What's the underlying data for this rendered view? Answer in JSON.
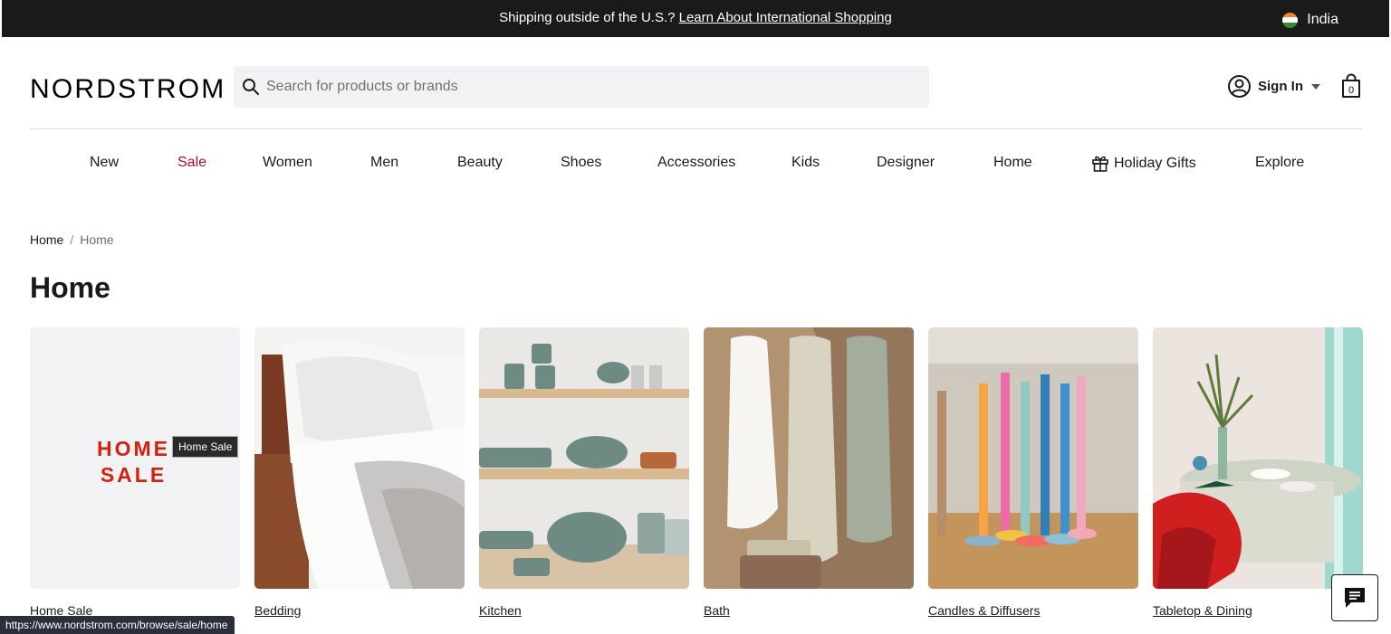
{
  "promo": {
    "text": "Shipping outside of the U.S.?",
    "link": "Learn About International Shopping",
    "country": "India"
  },
  "header": {
    "logo": "NORDSTROM",
    "search_placeholder": "Search for products or brands",
    "sign_in": "Sign In",
    "bag_count": "0"
  },
  "nav": [
    {
      "label": "New"
    },
    {
      "label": "Sale"
    },
    {
      "label": "Women"
    },
    {
      "label": "Men"
    },
    {
      "label": "Beauty"
    },
    {
      "label": "Shoes"
    },
    {
      "label": "Accessories"
    },
    {
      "label": "Kids"
    },
    {
      "label": "Designer"
    },
    {
      "label": "Home"
    },
    {
      "label": "Holiday Gifts",
      "icon": "gift-icon"
    },
    {
      "label": "Explore"
    }
  ],
  "breadcrumb": {
    "parent": "Home",
    "separator": "/",
    "current": "Home"
  },
  "page_title": "Home",
  "categories": [
    {
      "label": "Home Sale",
      "art_line1": "HOME",
      "art_line2": "SALE",
      "tooltip": "Home Sale"
    },
    {
      "label": "Bedding"
    },
    {
      "label": "Kitchen"
    },
    {
      "label": "Bath"
    },
    {
      "label": "Candles & Diffusers"
    },
    {
      "label": "Tabletop & Dining"
    }
  ],
  "status_bar_url": "https://www.nordstrom.com/browse/sale/home",
  "colors": {
    "sale_red": "#b3092c",
    "promo_bg": "#1a1a1a",
    "home_sale_text": "#d4200c"
  }
}
